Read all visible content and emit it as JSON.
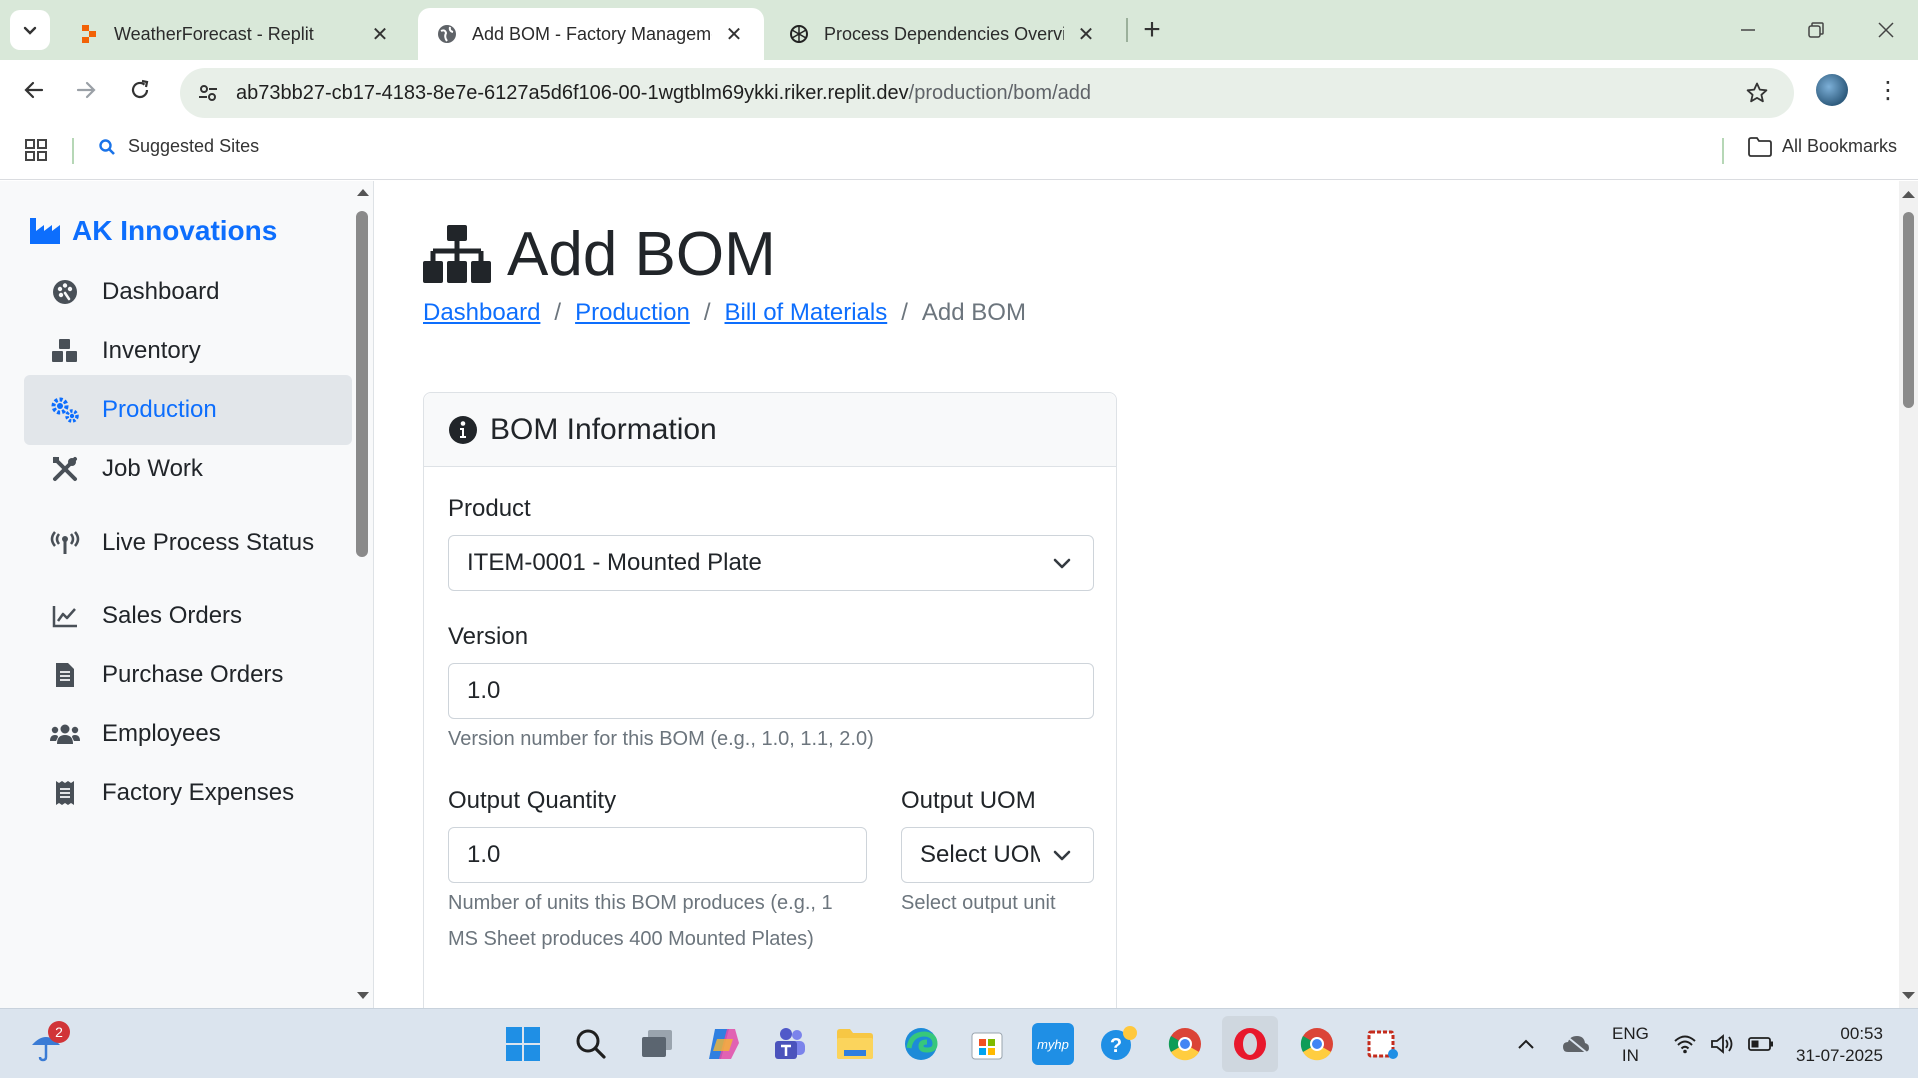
{
  "browser": {
    "tabs": [
      {
        "label": "WeatherForecast - Replit",
        "active": false
      },
      {
        "label": "Add BOM - Factory Management",
        "active": true
      },
      {
        "label": "Process Dependencies Overview",
        "active": false
      }
    ],
    "url_host": "ab73bb27-cb17-4183-8e7e-6127a5d6f106-00-1wgtblm69ykki.riker.replit.dev",
    "url_path": "/production/bom/add",
    "bookmarks": {
      "suggested": "Suggested Sites",
      "all": "All Bookmarks"
    }
  },
  "sidebar": {
    "brand": "AK Innovations",
    "items": [
      {
        "label": "Dashboard",
        "icon": "palette-icon"
      },
      {
        "label": "Inventory",
        "icon": "boxes-icon"
      },
      {
        "label": "Production",
        "icon": "gears-icon",
        "active": true
      },
      {
        "label": "Job Work",
        "icon": "tools-icon"
      },
      {
        "label": "Live Process Status",
        "icon": "broadcast-icon"
      },
      {
        "label": "Sales Orders",
        "icon": "chart-line-icon"
      },
      {
        "label": "Purchase Orders",
        "icon": "file-invoice-icon"
      },
      {
        "label": "Employees",
        "icon": "users-icon"
      },
      {
        "label": "Factory Expenses",
        "icon": "receipt-icon"
      }
    ]
  },
  "page": {
    "title": "Add BOM",
    "breadcrumb": [
      "Dashboard",
      "Production",
      "Bill of Materials",
      "Add BOM"
    ]
  },
  "form": {
    "card_title": "BOM Information",
    "product_label": "Product",
    "product_value": "ITEM-0001 - Mounted Plate",
    "version_label": "Version",
    "version_value": "1.0",
    "version_help": "Version number for this BOM (e.g., 1.0, 1.1, 2.0)",
    "output_qty_label": "Output Quantity",
    "output_qty_value": "1.0",
    "output_qty_help_line1": "Number of units this BOM produces (e.g., 1",
    "output_qty_help_line2": "MS Sheet produces 400 Mounted Plates)",
    "output_uom_label": "Output UOM",
    "output_uom_value": "Select UOM",
    "output_uom_help": "Select output unit"
  },
  "taskbar": {
    "weather_badge": "2",
    "lang_line1": "ENG",
    "lang_line2": "IN",
    "time": "00:53",
    "date": "31-07-2025"
  },
  "colors": {
    "accent": "#0d6efd",
    "tabbar": "#d9e8d9",
    "sidebar_bg": "#f8f9fa",
    "active_item_bg": "#e2e6ea"
  }
}
